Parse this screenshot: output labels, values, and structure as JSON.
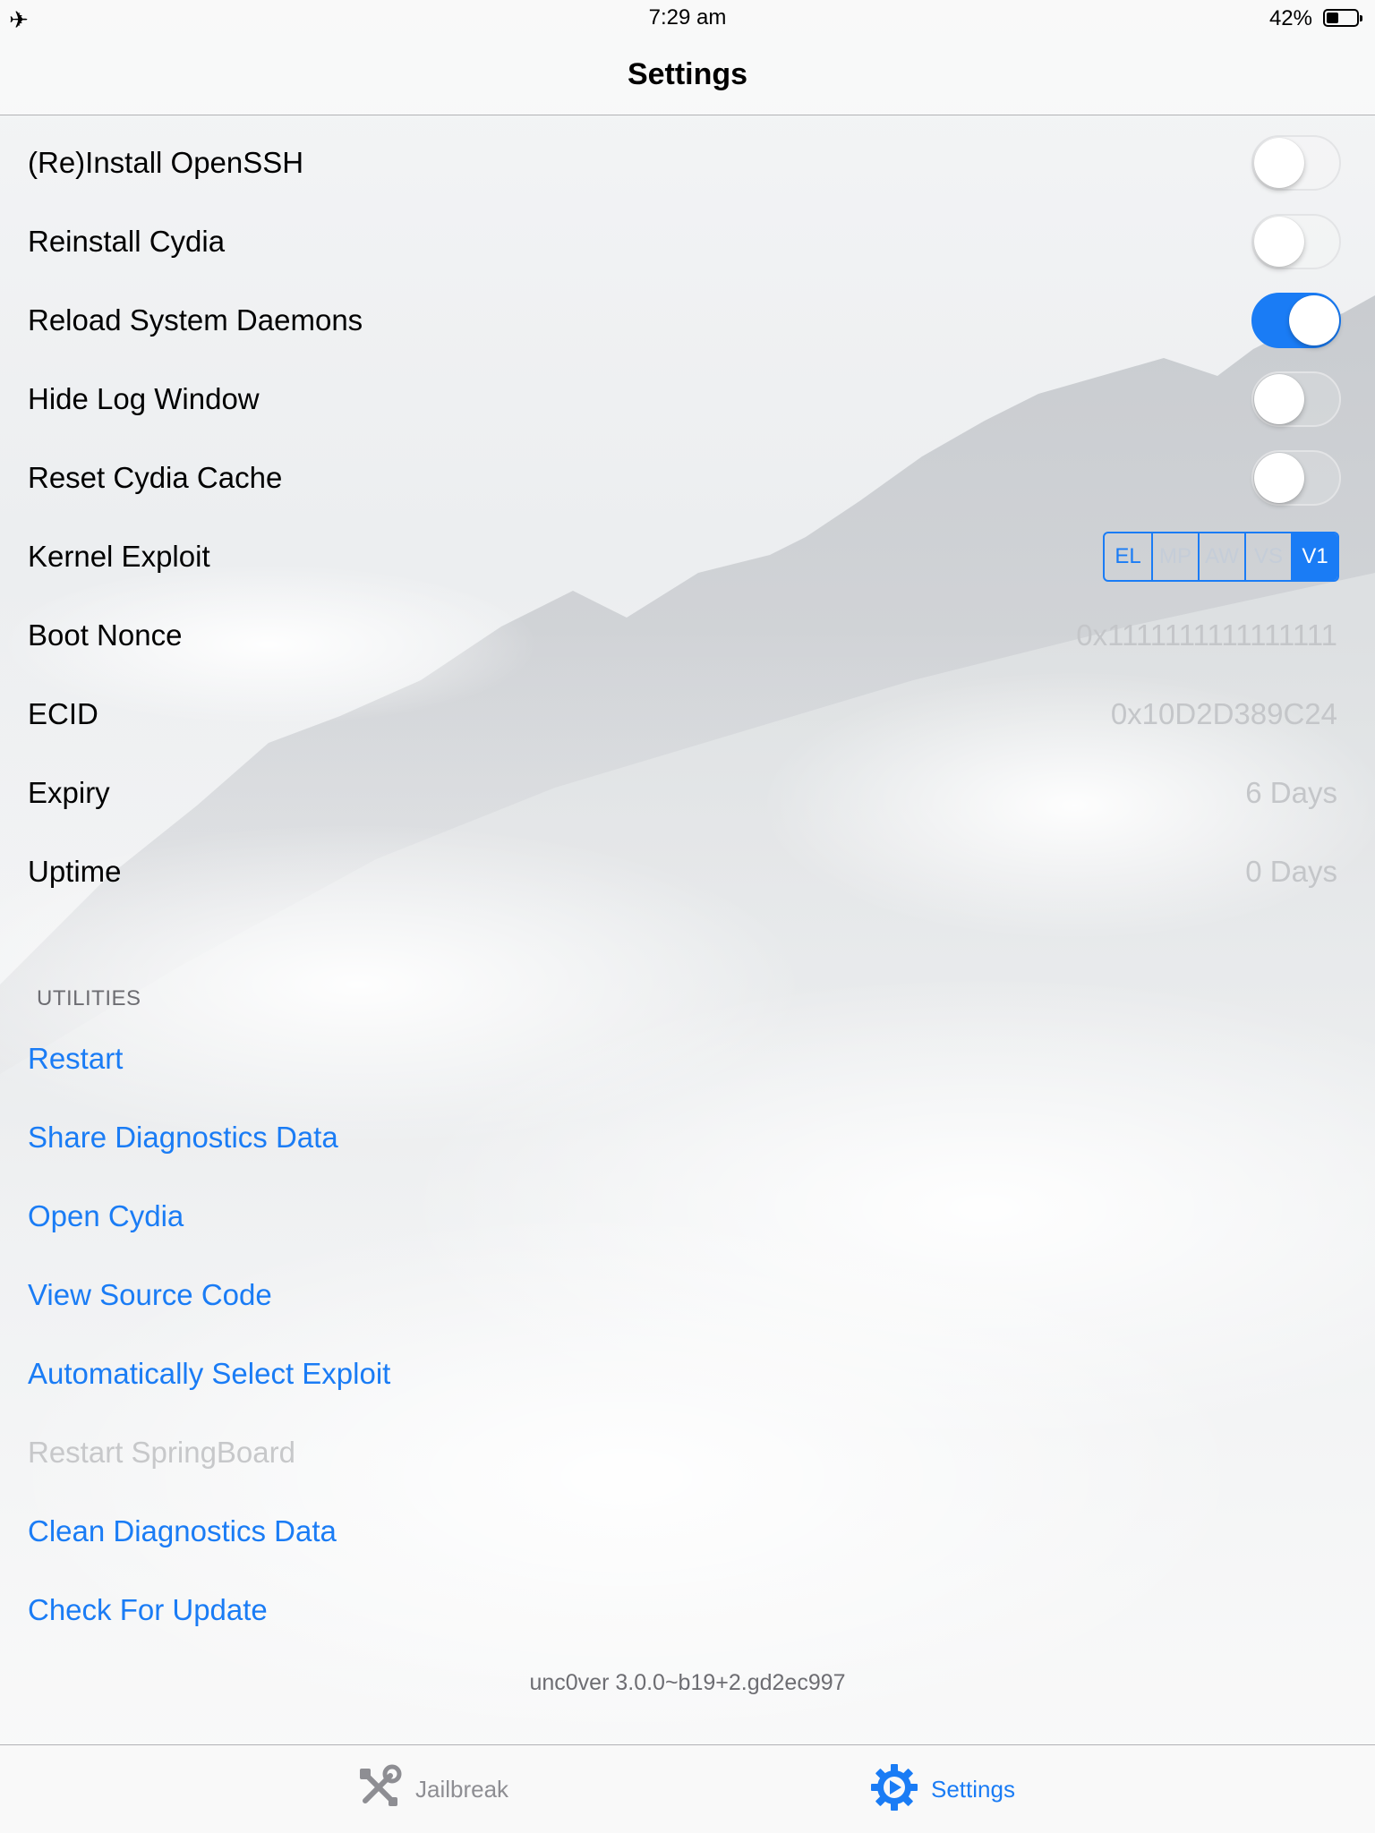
{
  "status_bar": {
    "time": "7:29 am",
    "battery_percent": "42%",
    "battery_level": 0.42,
    "airplane_icon": "airplane-icon"
  },
  "nav": {
    "title": "Settings"
  },
  "settings_rows": [
    {
      "label": "(Re)Install OpenSSH",
      "toggle": false
    },
    {
      "label": "Reinstall Cydia",
      "toggle": false
    },
    {
      "label": "Reload System Daemons",
      "toggle": true
    },
    {
      "label": "Hide Log Window",
      "toggle": false
    },
    {
      "label": "Reset Cydia Cache",
      "toggle": false
    }
  ],
  "kernel_exploit": {
    "label": "Kernel Exploit",
    "options": [
      "EL",
      "MP",
      "AW",
      "VS",
      "V1"
    ],
    "selected": "V1"
  },
  "info_rows": [
    {
      "label": "Boot Nonce",
      "value": "0x1111111111111111"
    },
    {
      "label": "ECID",
      "value": "0x10D2D389C24"
    },
    {
      "label": "Expiry",
      "value": "6 Days"
    },
    {
      "label": "Uptime",
      "value": "0 Days"
    }
  ],
  "utilities": {
    "header": "UTILITIES",
    "items": [
      {
        "label": "Restart",
        "enabled": true
      },
      {
        "label": "Share Diagnostics Data",
        "enabled": true
      },
      {
        "label": "Open Cydia",
        "enabled": true
      },
      {
        "label": "View Source Code",
        "enabled": true
      },
      {
        "label": "Automatically Select Exploit",
        "enabled": true
      },
      {
        "label": "Restart SpringBoard",
        "enabled": false
      },
      {
        "label": "Clean Diagnostics Data",
        "enabled": true
      },
      {
        "label": "Check For Update",
        "enabled": true
      }
    ]
  },
  "version": "unc0ver 3.0.0~b19+2.gd2ec997",
  "tabs": [
    {
      "label": "Jailbreak",
      "icon": "tools-icon",
      "active": false
    },
    {
      "label": "Settings",
      "icon": "gear-icon",
      "active": true
    }
  ],
  "colors": {
    "accent": "#1a7cf5",
    "disabled": "#c7c8ca",
    "value_text": "#c4c6c9",
    "section_header": "#6d6d72"
  }
}
